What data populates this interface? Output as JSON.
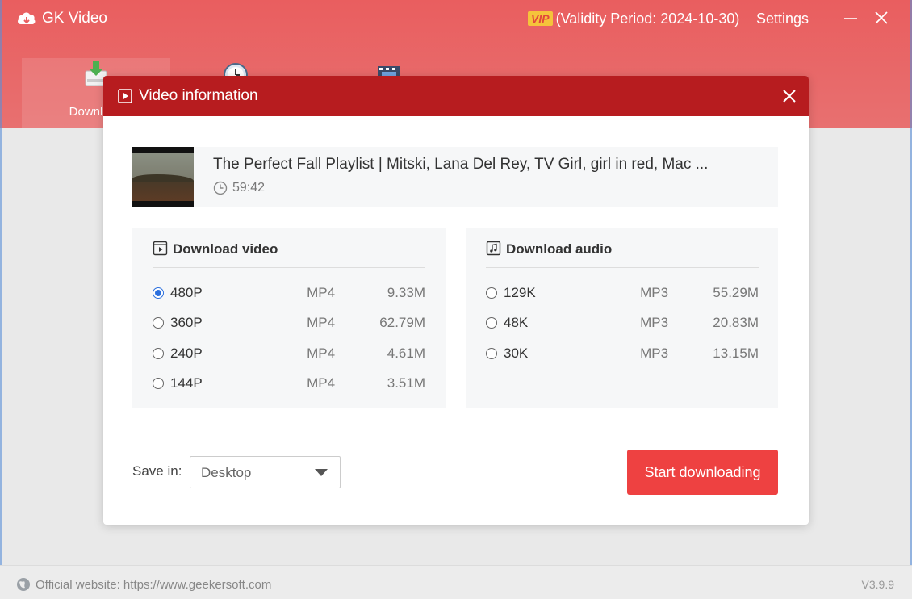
{
  "app": {
    "title": "GK Video",
    "vip_badge": "VIP",
    "validity": "(Validity Period: 2024-10-30)",
    "settings": "Settings"
  },
  "tabs": [
    {
      "label": "Download",
      "icon": "download-icon"
    },
    {
      "label": "",
      "icon": "clock-icon"
    },
    {
      "label": "",
      "icon": "film-icon"
    }
  ],
  "modal": {
    "title": "Video information",
    "video": {
      "title": "The Perfect Fall Playlist | Mitski, Lana Del Rey, TV Girl, girl in red, Mac ...",
      "duration": "59:42"
    },
    "video_panel": {
      "title": "Download video",
      "options": [
        {
          "quality": "480P",
          "format": "MP4",
          "size": "9.33M",
          "checked": true
        },
        {
          "quality": "360P",
          "format": "MP4",
          "size": "62.79M",
          "checked": false
        },
        {
          "quality": "240P",
          "format": "MP4",
          "size": "4.61M",
          "checked": false
        },
        {
          "quality": "144P",
          "format": "MP4",
          "size": "3.51M",
          "checked": false
        }
      ]
    },
    "audio_panel": {
      "title": "Download audio",
      "options": [
        {
          "quality": "129K",
          "format": "MP3",
          "size": "55.29M",
          "checked": false
        },
        {
          "quality": "48K",
          "format": "MP3",
          "size": "20.83M",
          "checked": false
        },
        {
          "quality": "30K",
          "format": "MP3",
          "size": "13.15M",
          "checked": false
        }
      ]
    },
    "save_label": "Save in:",
    "save_value": "Desktop",
    "start_button": "Start downloading"
  },
  "footer": {
    "website": "Official website: https://www.geekersoft.com",
    "version": "V3.9.9"
  },
  "colors": {
    "header": "#e95e5f",
    "modal_header": "#b71c1f",
    "accent_button": "#ee4141",
    "radio_checked": "#2b6fdd"
  }
}
